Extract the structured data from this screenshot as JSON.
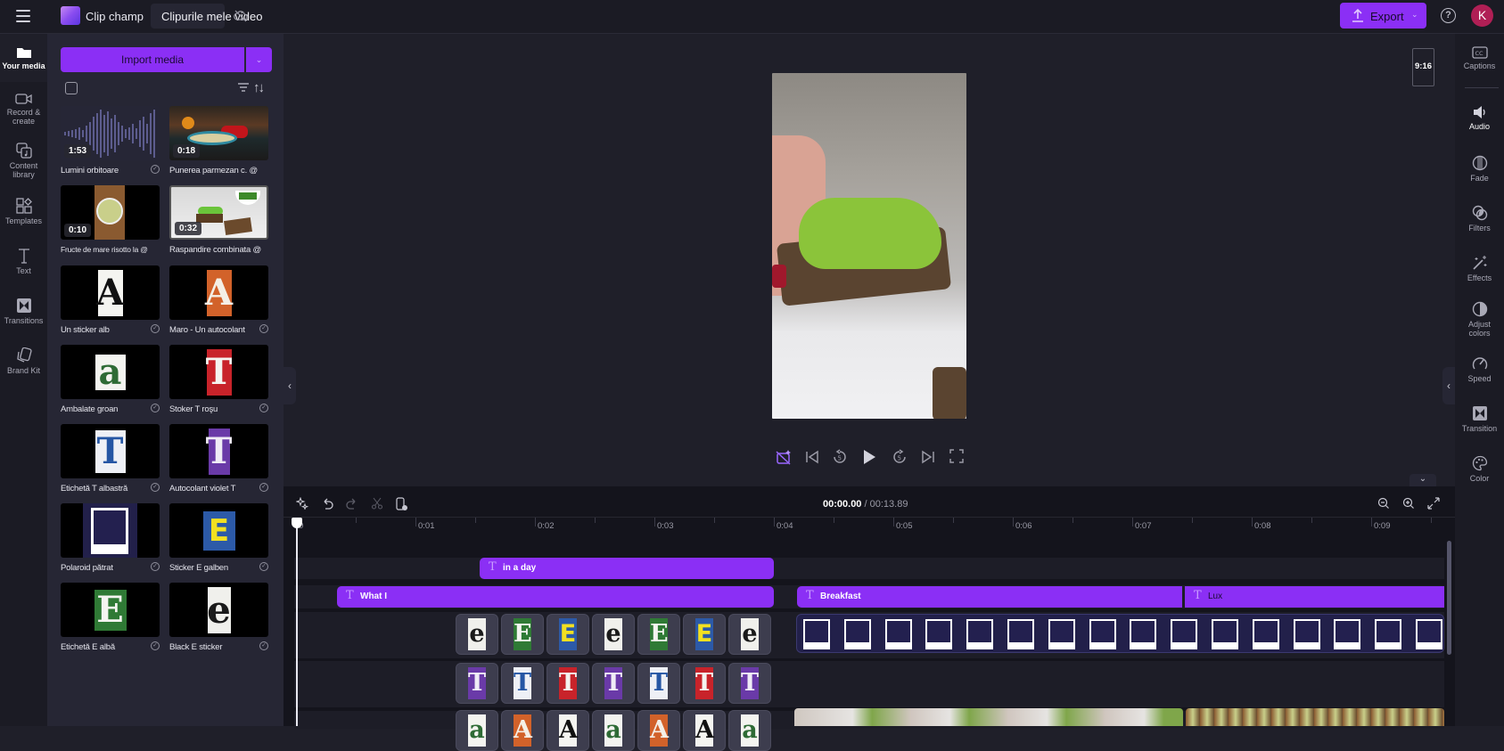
{
  "topbar": {
    "app_name": "Clip champ",
    "project_name": "Clipurile mele video",
    "export_label": "Export",
    "help_label": "?",
    "avatar_initial": "K",
    "accent": "#8b2ff5"
  },
  "left_nav": {
    "items": [
      {
        "label": "Your media",
        "icon": "folder-icon",
        "active": true
      },
      {
        "label": "Record &",
        "label2": "create",
        "icon": "camera-icon"
      },
      {
        "label": "Content",
        "label2": "library",
        "icon": "content-library-icon"
      },
      {
        "label": "Templates",
        "icon": "templates-icon"
      },
      {
        "label": "Text",
        "icon": "text-icon"
      },
      {
        "label": "Transitions",
        "icon": "transitions-icon"
      },
      {
        "label": "Brand Kit",
        "icon": "brand-kit-icon"
      }
    ]
  },
  "media": {
    "import_label": "Import media",
    "items": [
      {
        "name": "Lumini orbitoare",
        "duration": "1:53",
        "type": "audio"
      },
      {
        "name": "Punerea parmezan c. @",
        "duration": "0:18",
        "type": "video"
      },
      {
        "name": "Fructe de mare risotto la @",
        "duration": "0:10",
        "type": "video"
      },
      {
        "name": "Raspandire combinata @",
        "duration": "0:32",
        "type": "video"
      },
      {
        "name": "Un sticker alb",
        "glyph": "A",
        "type": "sticker"
      },
      {
        "name": "Maro - Un autocolant",
        "glyph": "A",
        "type": "sticker"
      },
      {
        "name": "Ambalate groan",
        "glyph": "a",
        "type": "sticker"
      },
      {
        "name": "Stoker T roşu",
        "glyph": "T",
        "type": "sticker"
      },
      {
        "name": "Etichetă T albastră",
        "glyph": "T",
        "type": "sticker"
      },
      {
        "name": "Autocolant violet T",
        "glyph": "T",
        "type": "sticker"
      },
      {
        "name": "Polaroid pătrat",
        "type": "polaroid"
      },
      {
        "name": "Sticker E galben",
        "glyph": "E",
        "type": "sticker"
      },
      {
        "name": "Etichetă E albă",
        "glyph": "E",
        "type": "sticker"
      },
      {
        "name": "Black E sticker",
        "glyph": "e",
        "type": "sticker"
      }
    ]
  },
  "preview": {
    "aspect_ratio": "9:16"
  },
  "right_nav": {
    "items": [
      {
        "label": "Captions",
        "icon": "captions-icon"
      },
      {
        "label": "Audio",
        "icon": "audio-icon",
        "active": true
      },
      {
        "label": "Fade",
        "icon": "fade-icon"
      },
      {
        "label": "Filters",
        "icon": "filters-icon"
      },
      {
        "label": "Effects",
        "icon": "effects-icon"
      },
      {
        "label": "Adjust",
        "label2": "colors",
        "icon": "adjust-colors-icon"
      },
      {
        "label": "Speed",
        "icon": "speed-icon"
      },
      {
        "label": "Transition",
        "icon": "transition-icon"
      },
      {
        "label": "Color",
        "icon": "color-palette-icon"
      }
    ]
  },
  "timeline": {
    "current_time": "00:00.00",
    "total_time": "/ 00:13.89",
    "ruler_labels": [
      "0",
      "0:01",
      "0:02",
      "0:03",
      "0:04",
      "0:05",
      "0:06",
      "0:07",
      "0:08",
      "0:09"
    ],
    "text_clips": [
      {
        "label": "in a day"
      },
      {
        "label": "What I"
      },
      {
        "label": "Breakfast"
      },
      {
        "label": "Lux"
      }
    ],
    "e_stickers": [
      "e",
      "E",
      "E",
      "e",
      "E",
      "E",
      "e"
    ],
    "t_stickers": [
      "T",
      "T",
      "T",
      "T",
      "T",
      "T",
      "T"
    ],
    "a_stickers": [
      "a",
      "A",
      "A",
      "a",
      "A",
      "A",
      "a"
    ]
  }
}
